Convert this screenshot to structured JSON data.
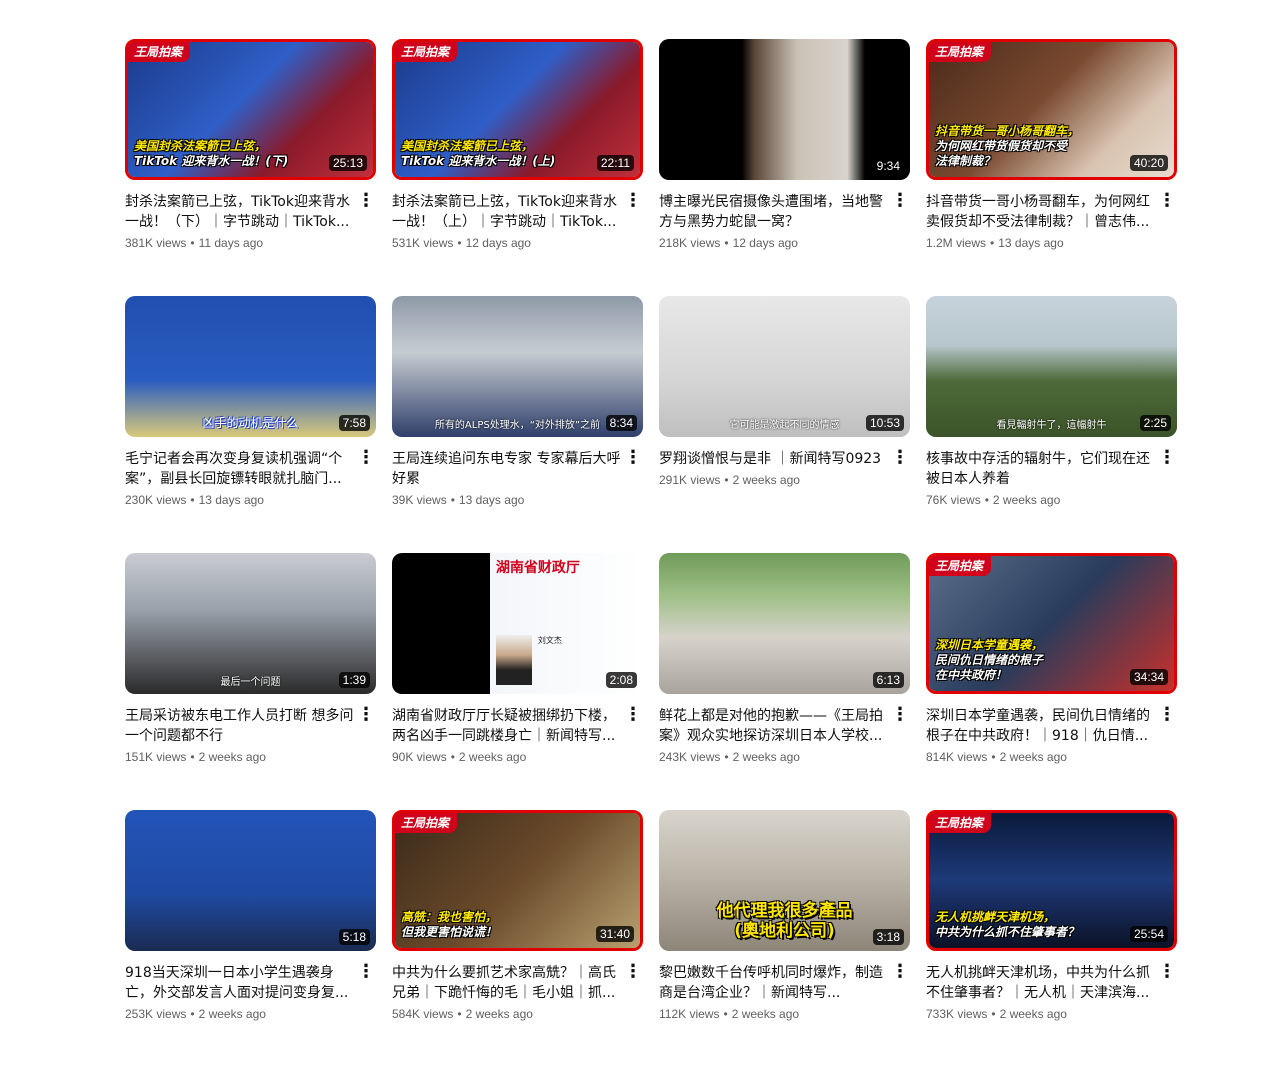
{
  "videos": [
    {
      "title": "封杀法案箭已上弦，TikTok迎来背水一战！（下）｜字节跳动｜TikTok...",
      "views": "381K views",
      "age": "11 days ago",
      "duration": "25:13",
      "badge": "王局拍案",
      "overlay1": "美国封杀法案箭已上弦，",
      "overlay2": "TikTok 迎来背水一战！(下)",
      "style": "flag"
    },
    {
      "title": "封杀法案箭已上弦，TikTok迎来背水一战！（上）｜字节跳动｜TikTok...",
      "views": "531K views",
      "age": "12 days ago",
      "duration": "22:11",
      "badge": "王局拍案",
      "overlay1": "美国封杀法案箭已上弦，",
      "overlay2": "TikTok 迎来背水一战！(上)",
      "style": "flag"
    },
    {
      "title": "博主曝光民宿摄像头遭围堵，当地警方与黑势力蛇鼠一窝？",
      "views": "218K views",
      "age": "12 days ago",
      "duration": "9:34",
      "style": "dark"
    },
    {
      "title": "抖音带货一哥小杨哥翻车，为何网红卖假货却不受法律制裁？｜曾志伟...",
      "views": "1.2M views",
      "age": "13 days ago",
      "duration": "40:20",
      "badge": "王局拍案",
      "overlay1": "抖音带货一哥小杨哥翻车，",
      "overlay2": "为何网红带货假货却不受",
      "overlay3": "法律制裁？",
      "style": "brown"
    },
    {
      "title": "毛宁记者会再次变身复读机强调“个案”，副县长回旋镖转眼就扎脑门...",
      "views": "230K views",
      "age": "13 days ago",
      "duration": "7:58",
      "sub": "凶手的动机是什么",
      "style": "blue"
    },
    {
      "title": "王局连续追问东电专家 专家幕后大呼好累",
      "views": "39K views",
      "age": "13 days ago",
      "duration": "8:34",
      "sub": "所有的ALPS处理水，“对外排放”之前",
      "style": "worker"
    },
    {
      "title": "罗翔谈憎恨与是非 ｜新闻特写0923",
      "views": "291K views",
      "age": "2 weeks ago",
      "duration": "10:53",
      "sub": "它可能是激起不同的情感",
      "style": "light"
    },
    {
      "title": "核事故中存活的辐射牛，它们现在还被日本人养着",
      "views": "76K views",
      "age": "2 weeks ago",
      "duration": "2:25",
      "sub": "看見輻射牛了，這幅射牛",
      "style": "green"
    },
    {
      "title": "王局采访被东电工作人员打断 想多问一个问题都不行",
      "views": "151K views",
      "age": "2 weeks ago",
      "duration": "1:39",
      "sub": "最后一个问题",
      "style": "office"
    },
    {
      "title": "湖南省财政厅厅长疑被捆绑扔下楼，两名凶手一同跳楼身亡｜新闻特写...",
      "views": "90K views",
      "age": "2 weeks ago",
      "duration": "2:08",
      "web_title": "湖南省财政厅",
      "web_name": "刘文杰",
      "style": "web"
    },
    {
      "title": "鲜花上都是对他的抱歉——《王局拍案》观众实地探访深圳日本人学校...",
      "views": "243K views",
      "age": "2 weeks ago",
      "duration": "6:13",
      "style": "street"
    },
    {
      "title": "深圳日本学童遇袭，民间仇日情绪的根子在中共政府！｜918｜仇日情...",
      "views": "814K views",
      "age": "2 weeks ago",
      "duration": "34:34",
      "badge": "王局拍案",
      "overlay1": "深圳日本学童遇袭，",
      "overlay2": "民间仇日情绪的根子",
      "overlay3": "在中共政府！",
      "style": "podium"
    },
    {
      "title": "918当天深圳一日本小学生遇袭身亡，外交部发言人面对提问变身复...",
      "views": "253K views",
      "age": "2 weeks ago",
      "duration": "5:18",
      "style": "blue2"
    },
    {
      "title": "中共为什么要抓艺术家高兟？｜高氏兄弟｜下跪忏悔的毛｜毛小姐｜抓...",
      "views": "584K views",
      "age": "2 weeks ago",
      "duration": "31:40",
      "badge": "王局拍案",
      "overlay1": "高兟：我也害怕，",
      "overlay2": "但我更害怕说谎！",
      "style": "art"
    },
    {
      "title": "黎巴嫩数千台传呼机同时爆炸，制造商是台湾企业？｜新闻特写...",
      "views": "112K views",
      "age": "2 weeks ago",
      "duration": "3:18",
      "bigcap1": "他代理我很多產品",
      "bigcap2": "(奧地利公司)",
      "style": "meeting"
    },
    {
      "title": "无人机挑衅天津机场，中共为什么抓不住肇事者？｜无人机｜天津滨海...",
      "views": "733K views",
      "age": "2 weeks ago",
      "duration": "25:54",
      "badge": "王局拍案",
      "overlay1": "无人机挑衅天津机场，",
      "overlay2": "中共为什么抓不住肇事者？",
      "style": "drone"
    }
  ],
  "colors": {
    "accent": "#e10000",
    "title": "#0f0f0f",
    "meta": "#606060"
  },
  "icons": {
    "more": "more-vert-icon"
  }
}
